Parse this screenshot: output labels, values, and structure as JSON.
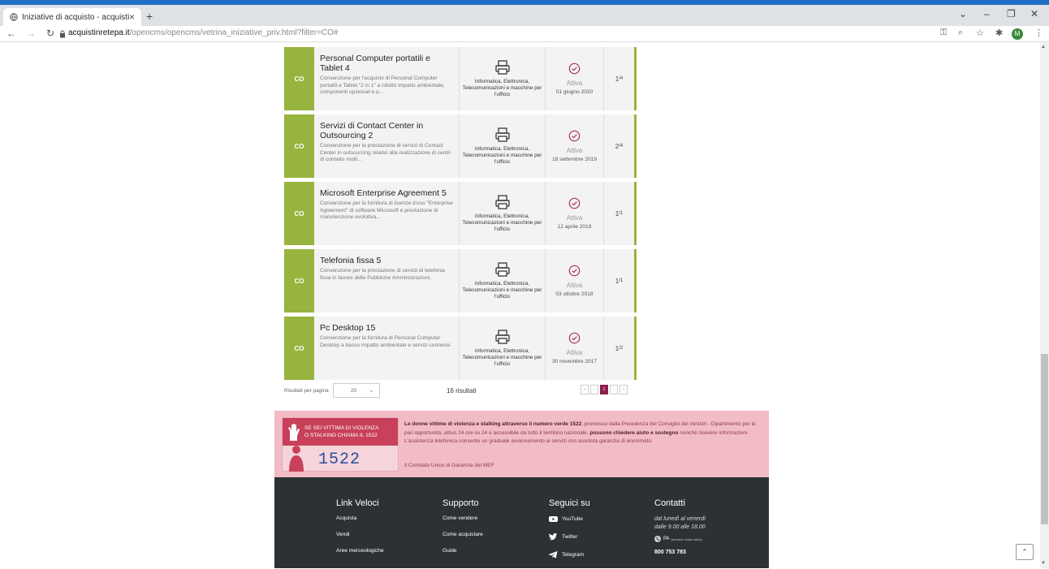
{
  "browser": {
    "tab_title": "Iniziative di acquisto - acquistin",
    "tab_close": "×",
    "new_tab": "+",
    "url_domain": "acquistinretepa.it",
    "url_path": "/opencms/opencms/vetrina_iniziative_priv.html?filter=CO#",
    "profile_initial": "M",
    "accent_color": "#1d6fc4"
  },
  "initiatives": [
    {
      "badge": "CO",
      "title": "Personal Computer portatili e Tablet 4",
      "description": "Convenzione per l'acquisto di Personal Computer portatili e Tablet \"2 in 1\" a ridotto impatto ambientale, componenti opzionali e p...",
      "category": "Informatica, Elettronica, Telecomunicazioni e macchine per l'ufficio",
      "status": "Attiva",
      "date": "01 giugno 2020",
      "lot": "1",
      "lot_total": "/4"
    },
    {
      "badge": "CO",
      "title": "Servizi di Contact Center in Outsourcing 2",
      "description": "Convenzione per la prestazione di servizi di Contact Center in outsourcing relativi alla realizzazione di centri di contatto multi...",
      "category": "Informatica, Elettronica, Telecomunicazioni e macchine per l'ufficio",
      "status": "Attiva",
      "date": "18 settembre 2019",
      "lot": "2",
      "lot_total": "/4"
    },
    {
      "badge": "CO",
      "title": "Microsoft Enterprise Agreement 5",
      "description": "Convenzione per la fornitura di licenze d'uso \"Enterprise Agreement\" di software Microsoft e prestazione di manutenzione evolutiva...",
      "category": "Informatica, Elettronica, Telecomunicazioni e macchine per l'ufficio",
      "status": "Attiva",
      "date": "12 aprile 2019",
      "lot": "1",
      "lot_total": "/1"
    },
    {
      "badge": "CO",
      "title": "Telefonia fissa 5",
      "description": "Convenzione per la prestazione di servizi di telefonia fissa in favore delle Pubbliche Amministrazioni.",
      "category": "Informatica, Elettronica, Telecomunicazioni e macchine per l'ufficio",
      "status": "Attiva",
      "date": "03 ottobre 2018",
      "lot": "1",
      "lot_total": "/1"
    },
    {
      "badge": "CO",
      "title": "Pc Desktop 15",
      "description": "Convenzione per la fornitura di Personal Computer Desktop a basso impatto ambientale e servizi connessi",
      "category": "Informatica, Elettronica, Telecomunicazioni e macchine per l'ufficio",
      "status": "Attiva",
      "date": "30 novembre 2017",
      "lot": "1",
      "lot_total": "/2"
    }
  ],
  "pager": {
    "per_page_label": "Risultati per pagina",
    "per_page_value": "20",
    "results": "16 risultati",
    "first": "«",
    "prev": "‹",
    "current": "1",
    "next": "›",
    "last": "»"
  },
  "banner": {
    "logo_text_1": "SE SEI VITTIMA DI VIOLENZA",
    "logo_text_2": "O STALKING CHIAMA IL 1522",
    "logo_number": "1522",
    "msg_bold_1": "Le donne vittime di violenza e stalking attraverso il numero verde 1522",
    "msg_1": ", promosso dalla Presidenza del Consiglio dei ministri - Dipartimento per le pari opportunità, attivo 24 ore su 24 e accessibile da tutto il territorio nazionale, ",
    "msg_bold_2": "possono chiedere aiuto e sostegno",
    "msg_2": " nonché ricevere informazioni. L'assistenza telefonica consente un graduale avvicinamento ai servizi con assoluta garanzia di anonimato.",
    "cug": "Il Comitato Unico di Garanzia del MEF",
    "color": "#f2bcc6"
  },
  "footer": {
    "link_veloci": {
      "heading": "Link Veloci",
      "items": [
        "Acquista",
        "Vendi",
        "Aree merceologiche"
      ]
    },
    "supporto": {
      "heading": "Supporto",
      "items": [
        "Come vendere",
        "Come acquistare",
        "Guide"
      ]
    },
    "seguici": {
      "heading": "Seguici su",
      "items": [
        "YouTube",
        "Twitter",
        "Telegram"
      ]
    },
    "contatti": {
      "heading": "Contatti",
      "hours_1": "dal lunedì al venerdì",
      "hours_2": "dalle 9.00 alle 18.00",
      "pa_label": "PA",
      "pa_small": "(numero verde unico)",
      "phone": "800 753 783"
    }
  }
}
